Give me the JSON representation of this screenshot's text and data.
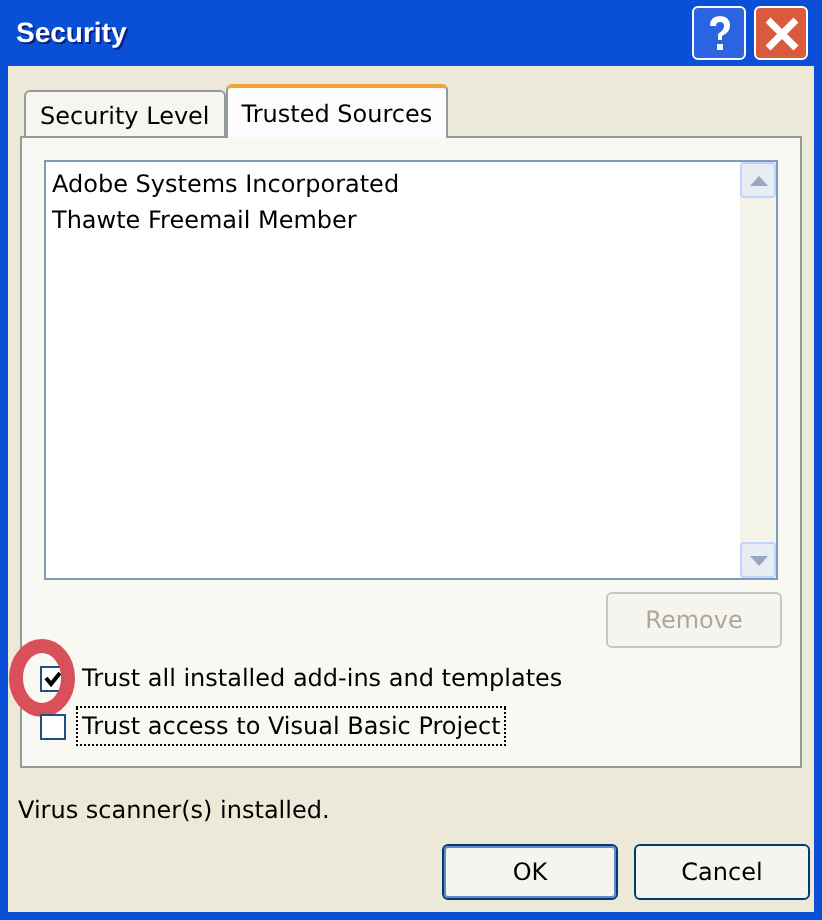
{
  "window": {
    "title": "Security"
  },
  "tabs": [
    {
      "label": "Security Level",
      "selected": false
    },
    {
      "label": "Trusted Sources",
      "selected": true
    }
  ],
  "sources": [
    "Adobe Systems Incorporated",
    "Thawte Freemail Member"
  ],
  "remove_button": {
    "label": "Remove",
    "disabled": true
  },
  "options": [
    {
      "label": "Trust all installed add-ins and templates",
      "checked": true,
      "highlighted": true,
      "focused": false
    },
    {
      "label": "Trust access to Visual Basic Project",
      "checked": false,
      "highlighted": false,
      "focused": true
    }
  ],
  "status": "Virus scanner(s) installed.",
  "buttons": [
    {
      "label": "OK",
      "default": true
    },
    {
      "label": "Cancel",
      "default": false
    }
  ]
}
